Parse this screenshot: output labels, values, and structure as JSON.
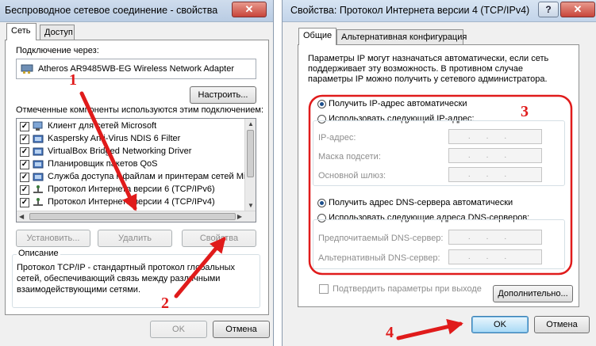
{
  "left_dialog": {
    "title": "Беспроводное сетевое соединение - свойства",
    "close_label": "✕",
    "tabs": [
      {
        "label": "Сеть",
        "active": true
      },
      {
        "label": "Доступ",
        "active": false
      }
    ],
    "connect_via_label": "Подключение через:",
    "adapter_name": "Atheros AR9485WB-EG Wireless Network Adapter",
    "configure_button": "Настроить...",
    "components_label": "Отмеченные компоненты используются этим подключением:",
    "components": [
      {
        "label": "Клиент для сетей Microsoft",
        "checked": true,
        "icon": "network-client-icon"
      },
      {
        "label": "Kaspersky Anti-Virus NDIS 6 Filter",
        "checked": true,
        "icon": "network-service-icon"
      },
      {
        "label": "VirtualBox Bridged Networking Driver",
        "checked": true,
        "icon": "network-service-icon"
      },
      {
        "label": "Планировщик пакетов QoS",
        "checked": true,
        "icon": "network-service-icon"
      },
      {
        "label": "Служба доступа к файлам и принтерам сетей Micro",
        "checked": true,
        "icon": "network-service-icon"
      },
      {
        "label": "Протокол Интернета версии 6 (TCP/IPv6)",
        "checked": true,
        "icon": "protocol-icon"
      },
      {
        "label": "Протокол Интернета версии 4 (TCP/IPv4)",
        "checked": true,
        "icon": "protocol-icon"
      }
    ],
    "install_button": "Установить...",
    "remove_button": "Удалить",
    "properties_button": "Свойства",
    "description_label": "Описание",
    "description_text": "Протокол TCP/IP - стандартный протокол глобальных сетей, обеспечивающий связь между различными взаимодействующими сетями.",
    "ok_button": "OK",
    "cancel_button": "Отмена"
  },
  "right_dialog": {
    "title": "Свойства: Протокол Интернета версии 4 (TCP/IPv4)",
    "help_label": "?",
    "close_label": "✕",
    "tabs": [
      {
        "label": "Общие",
        "active": true
      },
      {
        "label": "Альтернативная конфигурация",
        "active": false
      }
    ],
    "info_text": "Параметры IP могут назначаться автоматически, если сеть поддерживает эту возможность. В противном случае параметры IP можно получить у сетевого администратора.",
    "ip_auto_label": "Получить IP-адрес автоматически",
    "ip_auto_selected": true,
    "ip_manual_label": "Использовать следующий IP-адрес:",
    "ip_address_label": "IP-адрес:",
    "subnet_mask_label": "Маска подсети:",
    "gateway_label": "Основной шлюз:",
    "dns_auto_label": "Получить адрес DNS-сервера автоматически",
    "dns_auto_selected": true,
    "dns_manual_label": "Использовать следующие адреса DNS-серверов:",
    "preferred_dns_label": "Предпочитаемый DNS-сервер:",
    "alternate_dns_label": "Альтернативный DNS-сервер:",
    "validate_label": "Подтвердить параметры при выходе",
    "advanced_button": "Дополнительно...",
    "ok_button": "OK",
    "cancel_button": "Отмена"
  },
  "annotations": {
    "step1": "1",
    "step2": "2",
    "step3": "3",
    "step4": "4",
    "color": "#e01b1b"
  }
}
